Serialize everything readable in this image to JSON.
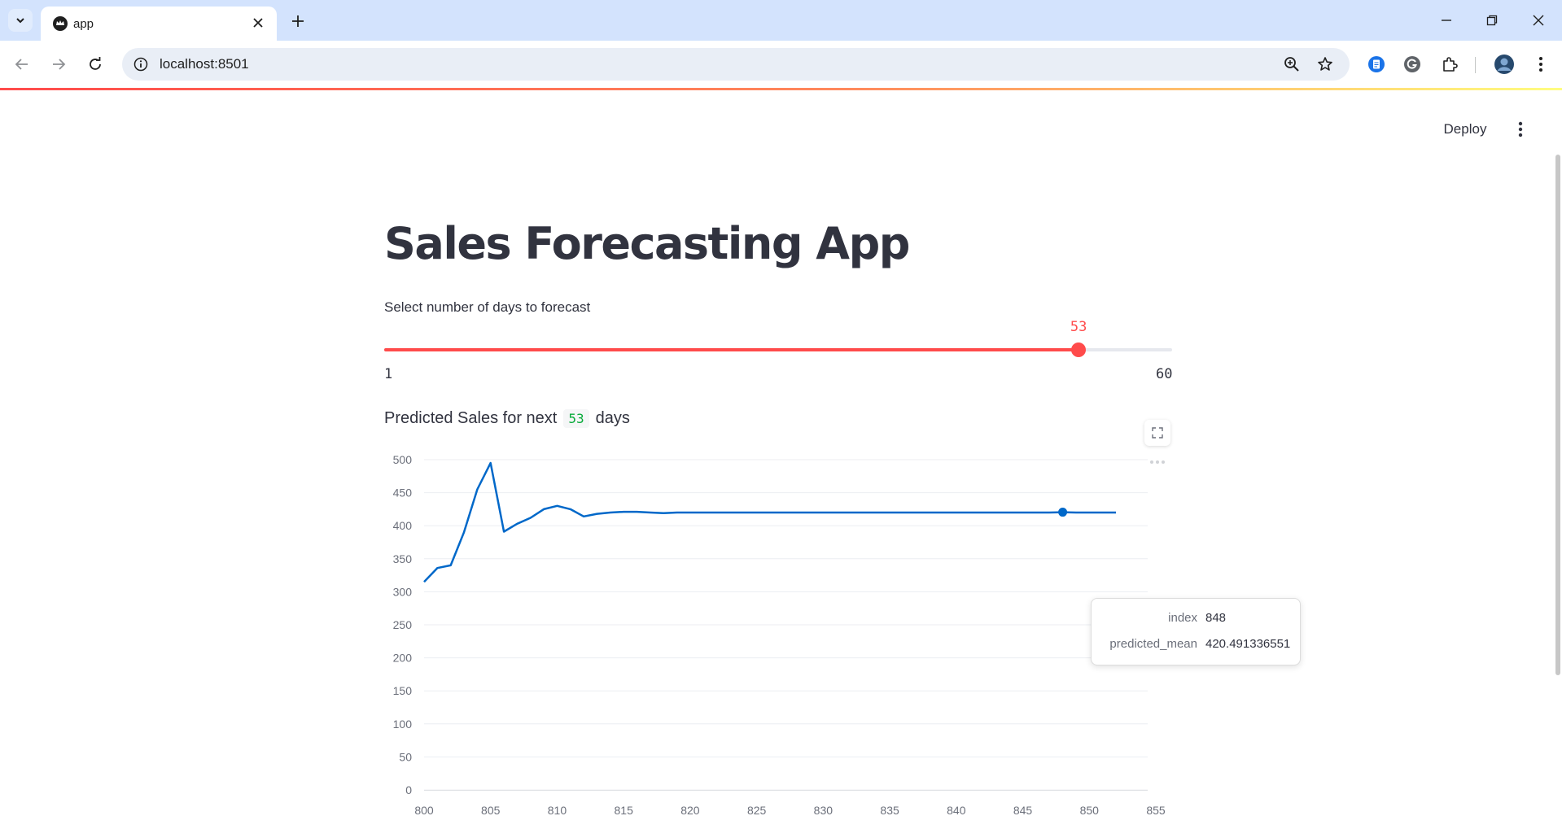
{
  "browser": {
    "tab_title": "app",
    "url": "localhost:8501"
  },
  "header": {
    "deploy_label": "Deploy"
  },
  "page": {
    "title": "Sales Forecasting App"
  },
  "slider": {
    "label": "Select number of days to forecast",
    "min": 1,
    "max": 60,
    "value": 53,
    "min_label": "1",
    "max_label": "60",
    "value_label": "53",
    "accent_color": "#ff4b4b"
  },
  "subheader": {
    "prefix": "Predicted Sales for next",
    "days_value": "53",
    "suffix": "days"
  },
  "tooltip": {
    "index_key": "index",
    "index_value": "848",
    "mean_key": "predicted_mean",
    "mean_value": "420.491336551"
  },
  "chart_data": {
    "type": "line",
    "title": "",
    "xlabel": "",
    "ylabel": "",
    "xlim": [
      800,
      855
    ],
    "ylim": [
      0,
      500
    ],
    "x_ticks": [
      800,
      805,
      810,
      815,
      820,
      825,
      830,
      835,
      840,
      845,
      850,
      855
    ],
    "y_ticks": [
      0,
      50,
      100,
      150,
      200,
      250,
      300,
      350,
      400,
      450,
      500
    ],
    "grid": true,
    "line_color": "#0068c9",
    "series": [
      {
        "x": [
          800,
          801,
          802,
          803,
          804,
          805,
          806,
          807,
          808,
          809,
          810,
          811,
          812,
          813,
          814,
          815,
          816,
          817,
          818,
          819,
          820,
          821,
          822,
          823,
          824,
          825,
          826,
          827,
          828,
          829,
          830,
          831,
          832,
          833,
          834,
          835,
          836,
          837,
          838,
          839,
          840,
          841,
          842,
          843,
          844,
          845,
          846,
          847,
          848,
          849,
          850,
          851,
          852
        ],
        "values": [
          315,
          336,
          340,
          390,
          455,
          495,
          391,
          403,
          412,
          425,
          430,
          425,
          414,
          418,
          420,
          421,
          421,
          420,
          419,
          420,
          420,
          420,
          420,
          420,
          420,
          420,
          420,
          420,
          420,
          420,
          420,
          420,
          420,
          420,
          420,
          420,
          420,
          420,
          420,
          420,
          420,
          420,
          420,
          420,
          420,
          420,
          420,
          420,
          420.491336551,
          420,
          420,
          420,
          420
        ]
      }
    ],
    "highlight": {
      "x": 848,
      "y": 420.491336551
    }
  }
}
